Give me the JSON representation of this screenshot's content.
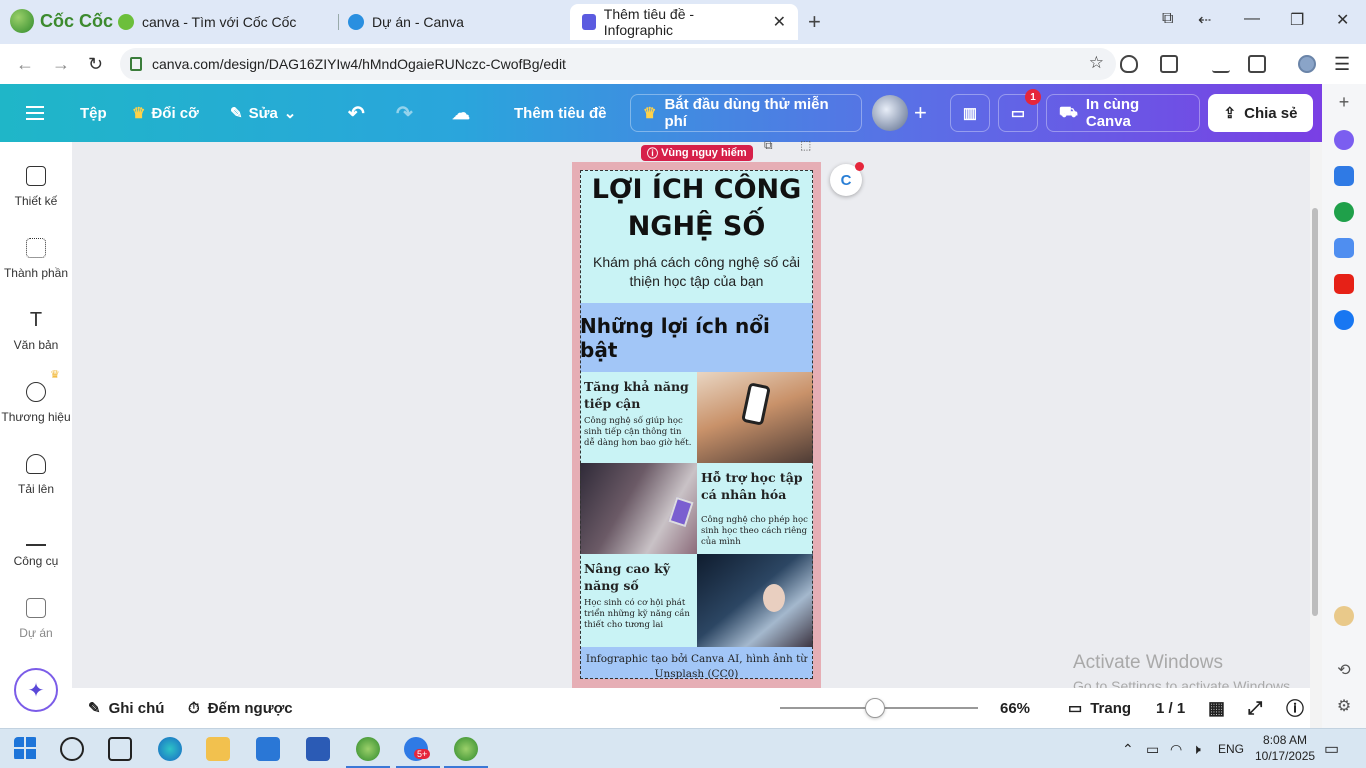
{
  "browser": {
    "brand": "Cốc Cốc",
    "tabs": [
      {
        "label": "canva - Tìm với Cốc Cốc"
      },
      {
        "label": "Dự án - Canva"
      },
      {
        "label": "Thêm tiêu đề - Infographic",
        "active": true
      }
    ],
    "url": "canva.com/design/DAG16ZIYIw4/hMndOgaieRUNczc-CwofBg/edit"
  },
  "canva_toolbar": {
    "file": "Tệp",
    "resize": "Đổi cỡ",
    "edit": "Sửa",
    "title": "Thêm tiêu đề",
    "trial": "Bắt đầu dùng thử miễn phí",
    "comments_badge": "1",
    "print": "In cùng Canva",
    "share": "Chia sẻ"
  },
  "sidebar": {
    "items": [
      {
        "label": "Thiết kế",
        "icon": "design-icon"
      },
      {
        "label": "Thành phần",
        "icon": "elements-icon"
      },
      {
        "label": "Văn bản",
        "icon": "text-icon"
      },
      {
        "label": "Thương hiệu",
        "icon": "brand-icon"
      },
      {
        "label": "Tải lên",
        "icon": "upload-icon"
      },
      {
        "label": "Công cụ",
        "icon": "tools-icon"
      },
      {
        "label": "Dự án",
        "icon": "projects-icon"
      }
    ]
  },
  "design": {
    "danger_label": "Vùng nguy hiểm",
    "title": "LỢI ÍCH CÔNG NGHỆ SỐ",
    "subtitle": "Khám phá cách công nghệ số cải thiện học tập của bạn",
    "banner": "Những lợi ích nổi bật",
    "benefits": [
      {
        "title": "Tăng khả năng tiếp cận",
        "desc": "Công nghệ số giúp học sinh tiếp cận thông tin dễ dàng hơn bao giờ hết."
      },
      {
        "title": "Hỗ trợ học tập cá nhân hóa",
        "desc": "Công nghệ cho phép học sinh học theo cách riêng của mình"
      },
      {
        "title": "Nâng cao kỹ năng số",
        "desc": "Học sinh có cơ hội phát triển những kỹ năng cần thiết cho tương lai"
      }
    ],
    "footer": "Infographic tạo bởi Canva AI, hình ảnh từ Unsplash (CC0)"
  },
  "bottombar": {
    "notes": "Ghi chú",
    "timer": "Đếm ngược",
    "zoom": "66%",
    "zoom_fraction": 0.48,
    "pages_label": "Trang",
    "page_count": "1 / 1"
  },
  "watermark": {
    "line1": "Activate Windows",
    "line2": "Go to Settings to activate Windows."
  },
  "taskbar": {
    "lang": "ENG",
    "time": "8:08 AM",
    "date": "10/17/2025",
    "notif_badge": "5+"
  }
}
